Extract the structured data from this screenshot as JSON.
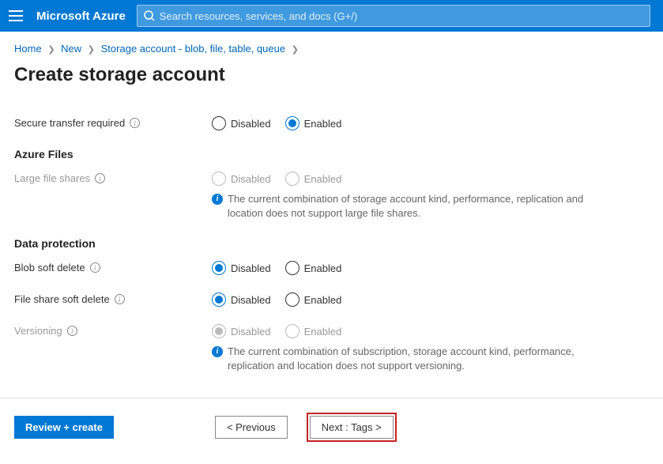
{
  "header": {
    "brand": "Microsoft Azure",
    "search_placeholder": "Search resources, services, and docs (G+/)"
  },
  "breadcrumb": {
    "items": [
      "Home",
      "New",
      "Storage account - blob, file, table, queue"
    ]
  },
  "page": {
    "title": "Create storage account"
  },
  "form": {
    "secure_transfer": {
      "label": "Secure transfer required",
      "disabled_opt": "Disabled",
      "enabled_opt": "Enabled"
    },
    "azure_files_head": "Azure Files",
    "large_file": {
      "label": "Large file shares",
      "disabled_opt": "Disabled",
      "enabled_opt": "Enabled",
      "note": "The current combination of storage account kind, performance, replication and location does not support large file shares."
    },
    "data_protection_head": "Data protection",
    "blob_soft": {
      "label": "Blob soft delete",
      "disabled_opt": "Disabled",
      "enabled_opt": "Enabled"
    },
    "file_soft": {
      "label": "File share soft delete",
      "disabled_opt": "Disabled",
      "enabled_opt": "Enabled"
    },
    "versioning": {
      "label": "Versioning",
      "disabled_opt": "Disabled",
      "enabled_opt": "Enabled",
      "note": "The current combination of subscription, storage account kind, performance, replication and location does not support versioning."
    }
  },
  "footer": {
    "review": "Review + create",
    "prev": "< Previous",
    "next": "Next : Tags >"
  }
}
